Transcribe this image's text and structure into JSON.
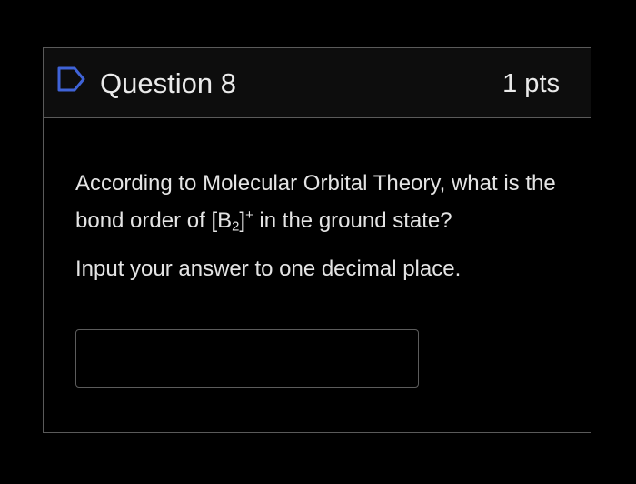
{
  "question": {
    "title": "Question 8",
    "points": "1 pts",
    "flag_icon": "flag-question-icon",
    "text_part1": "According to Molecular Orbital Theory, what is the bond order of [B",
    "subscript": "2",
    "text_part2": "]",
    "superscript": "+",
    "text_part3": " in the ground state?",
    "instruction": "Input your answer to one decimal place.",
    "answer_value": "",
    "answer_placeholder": ""
  },
  "colors": {
    "background": "#000000",
    "header_background": "#0d0d0d",
    "border": "#5a5a5a",
    "text": "#e4e4e4",
    "icon_accent": "#3f63d8"
  }
}
